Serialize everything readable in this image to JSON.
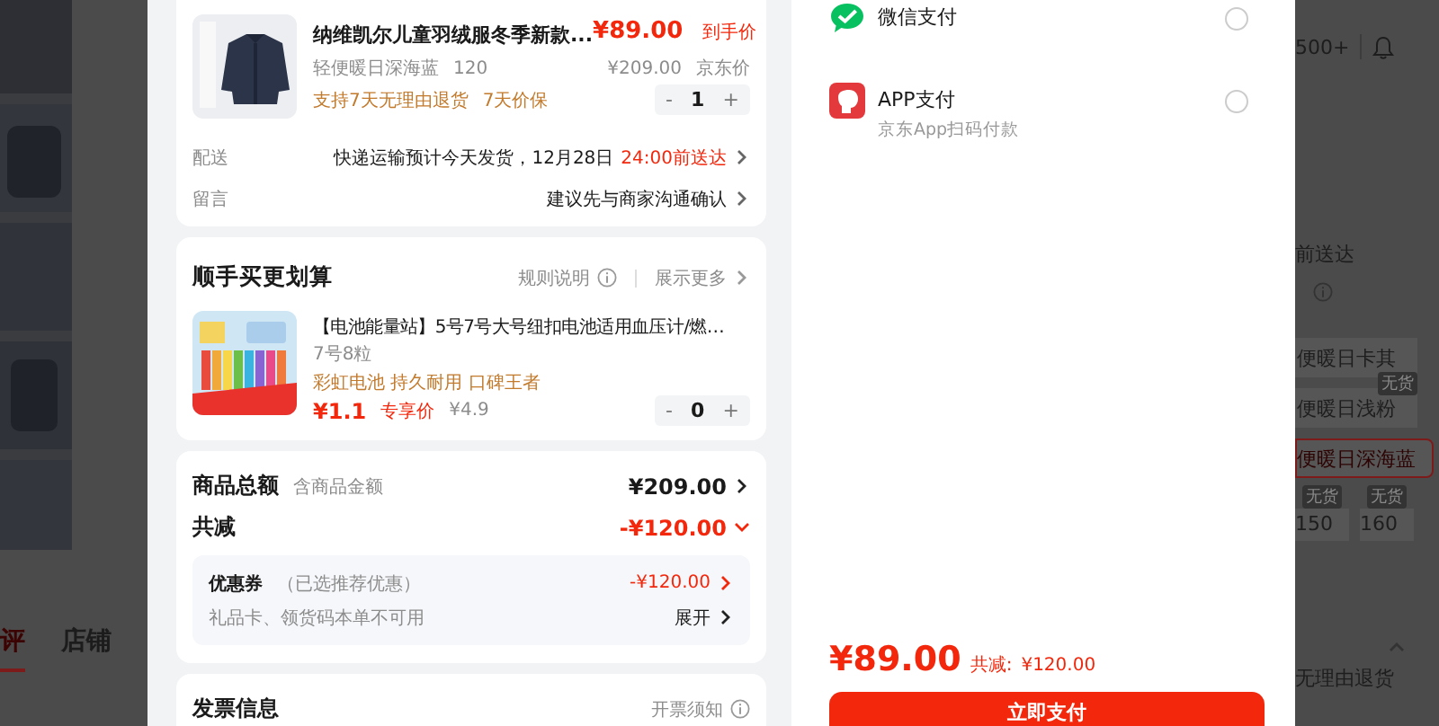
{
  "background_left": {
    "tabs": [
      {
        "label": "评",
        "selected": true
      },
      {
        "label": "店铺",
        "selected": false
      }
    ]
  },
  "order_item": {
    "title": "纳维凯尔儿童羽绒服冬季新款...",
    "spec": "轻便暖日深海蓝",
    "size": "120",
    "price": "¥89.00",
    "price_label": "到手价",
    "original_price": "¥209.00",
    "original_label": "京东价",
    "service_tags": [
      "支持7天无理由退货",
      "7天价保"
    ],
    "quantity": {
      "minus": "-",
      "value": "1",
      "plus": "+"
    }
  },
  "delivery": {
    "label": "配送",
    "text": "快递运输预计今天发货，12月28日",
    "highlight": "24:00前送达"
  },
  "message": {
    "label": "留言",
    "text": "建议先与商家沟通确认"
  },
  "addon": {
    "title": "顺手买更划算",
    "rule_link": "规则说明",
    "more_link": "展示更多",
    "item": {
      "title": "【电池能量站】5号7号大号纽扣电池适用血压计/燃…",
      "spec": "7号8粒",
      "tags": "彩虹电池 持久耐用 口碑王者",
      "price": "¥1.1",
      "price_label": "专享价",
      "original_price": "¥4.9",
      "quantity": {
        "minus": "-",
        "value": "0",
        "plus": "+"
      }
    }
  },
  "summary": {
    "goods_total": {
      "label": "商品总额",
      "note": "含商品金额",
      "value": "¥209.00"
    },
    "discount": {
      "label": "共减",
      "value": "-¥120.00",
      "expanded": true
    },
    "coupon": {
      "label": "优惠券",
      "note": "（已选推荐优惠）",
      "value": "-¥120.00"
    },
    "gift_card": {
      "text": "礼品卡、领货码本单不可用",
      "action": "展开"
    }
  },
  "invoice": {
    "title": "发票信息",
    "notice": "开票须知"
  },
  "payment_methods": [
    {
      "kind": "wechat",
      "name": "微信支付",
      "selected": false
    },
    {
      "kind": "app",
      "name": "APP支付",
      "subtitle": "京东App扫码付款",
      "selected": false
    }
  ],
  "pay_bar": {
    "total": "¥89.00",
    "discount_label": "共减:",
    "discount_value": "¥120.00",
    "button": "立即支付"
  },
  "background_right": {
    "sales": "500+",
    "delivery": "前送达",
    "colors": [
      {
        "label": "便暖日卡其",
        "selected": false
      },
      {
        "label": "便暖日浅粉",
        "selected": false,
        "badge": "无货"
      },
      {
        "label": "便暖日深海蓝",
        "selected": true
      }
    ],
    "sizes": [
      {
        "label": "150",
        "badge": "无货"
      },
      {
        "label": "160",
        "badge": "无货"
      }
    ],
    "service": "无理由退货"
  }
}
